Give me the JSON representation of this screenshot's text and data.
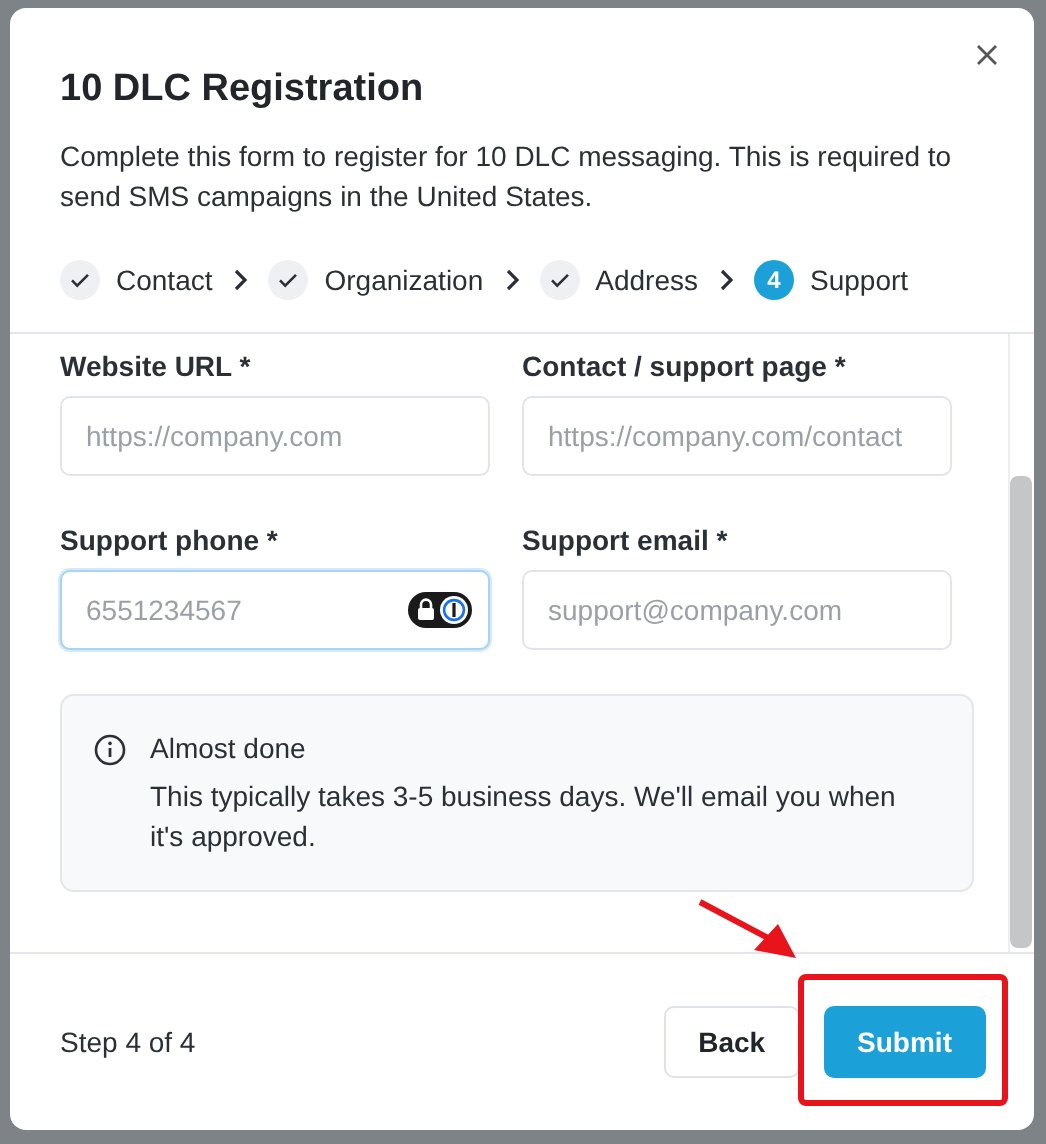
{
  "dialog": {
    "title": "10 DLC Registration",
    "description": "Complete this form to register for 10 DLC messaging. This is required to send SMS campaigns in the United States."
  },
  "steps": [
    {
      "label": "Contact",
      "done": true,
      "selected": false
    },
    {
      "label": "Organization",
      "done": true,
      "selected": false
    },
    {
      "label": "Address",
      "done": true,
      "selected": false
    },
    {
      "label": "Support",
      "done": false,
      "selected": true,
      "number": "4"
    }
  ],
  "fields": [
    {
      "label": "Website URL *",
      "placeholder": "https://company.com",
      "focused": false
    },
    {
      "label": "Contact / support page *",
      "placeholder": "https://company.com/contact",
      "focused": false
    },
    {
      "label": "Support phone *",
      "placeholder": "6551234567",
      "focused": true,
      "password_manager": true
    },
    {
      "label": "Support email *",
      "placeholder": "support@company.com",
      "focused": false
    }
  ],
  "notice": {
    "title": "Almost done",
    "text": "This typically takes 3-5 business days. We'll email you when it's approved."
  },
  "footer": {
    "step_text": "Step 4 of 4",
    "buttons": [
      {
        "label": "Back",
        "kind": "secondary"
      },
      {
        "label": "Submit",
        "kind": "primary",
        "highlighted": true
      }
    ]
  }
}
